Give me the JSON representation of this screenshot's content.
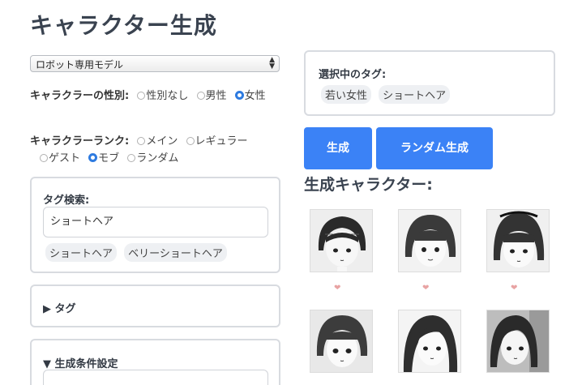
{
  "page": {
    "title": "キャラクター生成"
  },
  "model_select": {
    "value": "ロボット専用モデル"
  },
  "gender": {
    "label": "キャラクラーの性別:",
    "options": [
      "性別なし",
      "男性",
      "女性"
    ],
    "selected": "女性"
  },
  "rank": {
    "label": "キャラクラーランク:",
    "options": [
      "メイン",
      "レギュラー",
      "ゲスト",
      "モブ",
      "ランダム"
    ],
    "selected": "モブ"
  },
  "tag_search": {
    "label": "タグ検索:",
    "value": "ショートヘア",
    "suggestions": [
      "ショートヘア",
      "ベリーショートヘア"
    ]
  },
  "tag_panel": {
    "label": "▶ タグ"
  },
  "condition_panel": {
    "label": "▼ 生成条件設定"
  },
  "selected_tags": {
    "label": "選択中のタグ:",
    "tags": [
      "若い女性",
      "ショートヘア"
    ]
  },
  "buttons": {
    "generate": "生成",
    "random_generate": "ランダム生成"
  },
  "results": {
    "title": "生成キャラクター:",
    "items": [
      {
        "icon": "heart-icon"
      },
      {
        "icon": "heart-icon"
      },
      {
        "icon": "heart-icon"
      },
      {
        "icon": "heart-icon"
      },
      {
        "icon": "heart-icon"
      },
      {
        "icon": "heart-icon"
      }
    ]
  },
  "colors": {
    "accent": "#3b82f6",
    "heart": "#e8a3a3",
    "chip_bg": "#eef0f3"
  }
}
